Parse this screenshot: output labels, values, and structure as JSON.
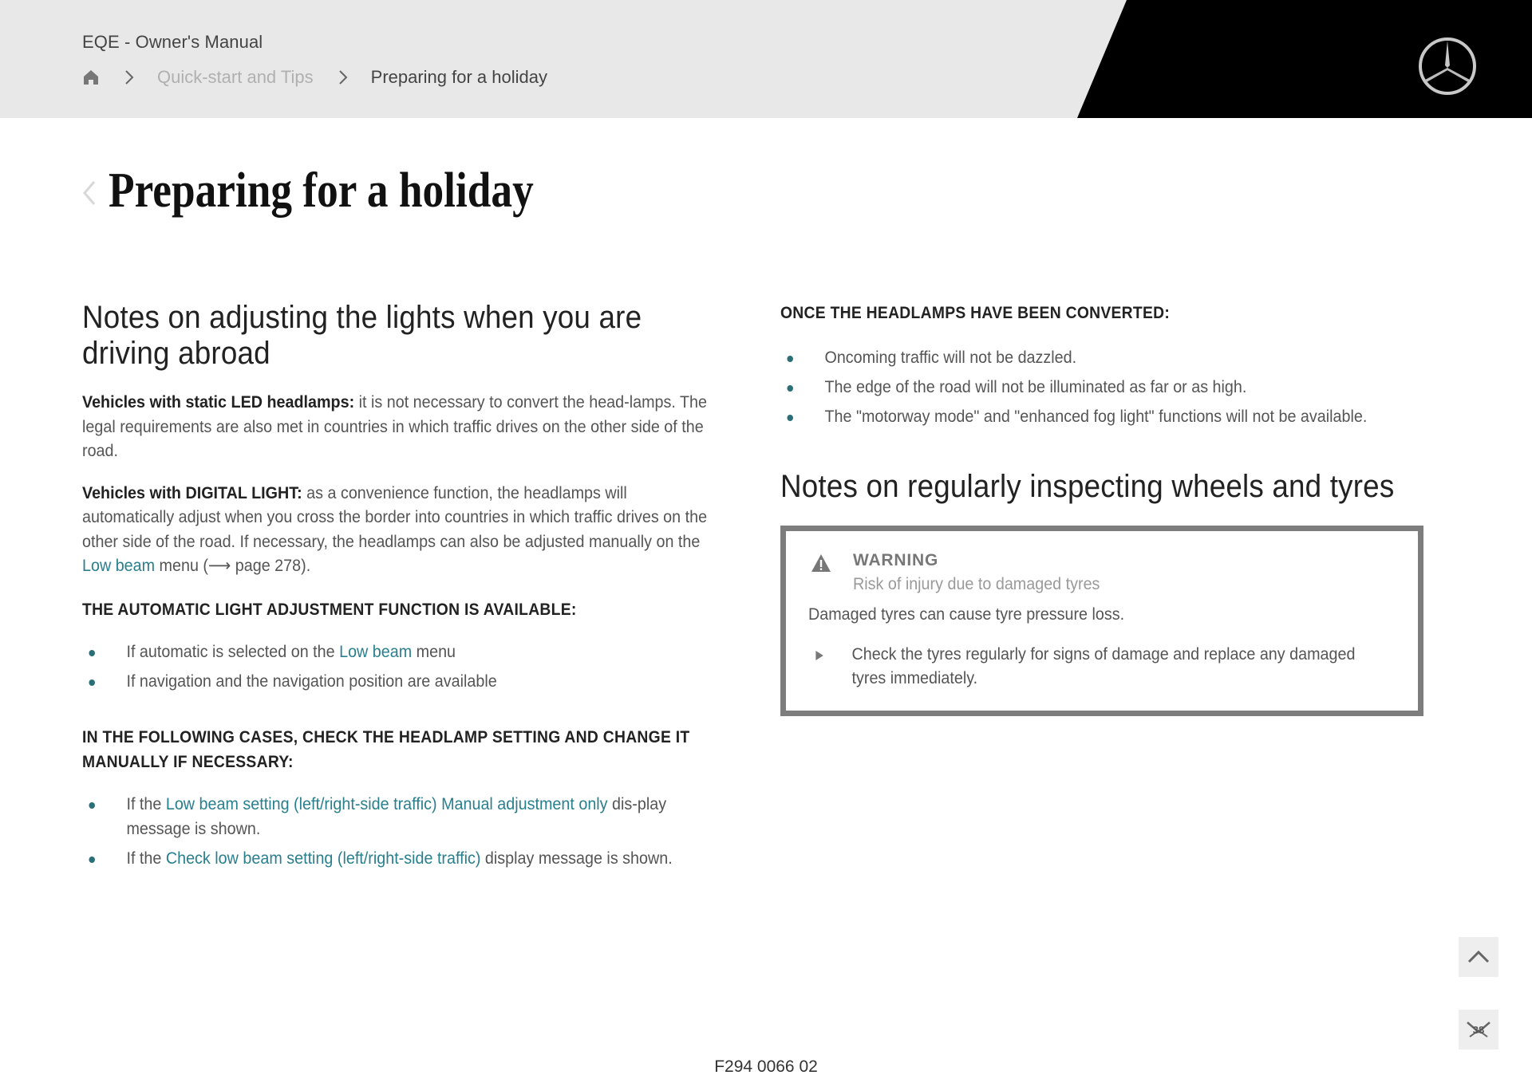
{
  "header": {
    "app_title": "EQE - Owner's Manual",
    "breadcrumb": {
      "home_icon": "home-icon",
      "separator_icon": "chevron-right-icon",
      "items": [
        {
          "label": "Quick-start and Tips"
        },
        {
          "label": "Preparing for a holiday"
        }
      ]
    },
    "logo": "mercedes-star-logo",
    "colors": {
      "bar": "#e8e8e8",
      "brand_block": "#000000"
    }
  },
  "page": {
    "back_icon": "chevron-left-icon",
    "title": "Preparing for a holiday"
  },
  "left_column": {
    "section_title": "Notes on adjusting the lights when you are driving abroad",
    "para1": {
      "bold": "Vehicles with static LED headlamps:",
      "text": " it is not necessary to convert the head-lamps. The legal requirements are also met in countries in which traffic drives on the other side of the road."
    },
    "para2": {
      "bold": "Vehicles with DIGITAL LIGHT:",
      "text_before": " as a convenience function, the headlamps will automatically adjust when you cross the border into countries in which traffic drives on the other side of the road. If necessary, the headlamps can also be adjusted manually on the ",
      "link": "Low beam",
      "text_after": " menu (⟶ page 278)."
    },
    "sub1": {
      "heading": "THE AUTOMATIC LIGHT ADJUSTMENT FUNCTION IS AVAILABLE:",
      "items": [
        {
          "before": "If automatic is selected on the ",
          "link": "Low beam",
          "after": " menu"
        },
        {
          "before": "If navigation and the navigation position are available",
          "link": "",
          "after": ""
        }
      ]
    },
    "sub2": {
      "heading": "IN THE FOLLOWING CASES, CHECK THE HEADLAMP SETTING AND CHANGE IT MANUALLY IF NECESSARY:",
      "items": [
        {
          "before": "If the ",
          "link": "Low beam setting (left/right-side traffic) Manual adjustment only",
          "after": " dis-play message is shown."
        },
        {
          "before": "If the ",
          "link": "Check low beam setting (left/right-side traffic)",
          "after": " display message is shown."
        }
      ]
    }
  },
  "right_column": {
    "sub_heading": "ONCE THE HEADLAMPS HAVE BEEN CONVERTED:",
    "items": [
      "Oncoming traffic will not be dazzled.",
      "The edge of the road will not be illuminated as far or as high.",
      "The \"motorway mode\" and \"enhanced fog light\" functions will not be available."
    ],
    "section_title": "Notes on regularly inspecting wheels and tyres",
    "warning": {
      "icon": "warning-triangle-icon",
      "title": "WARNING",
      "subtitle": "Risk of injury due to damaged tyres",
      "text": "Damaged tyres can cause tyre pressure loss.",
      "step_icon": "play-triangle-icon",
      "step": "Check the tyres regularly for signs of damage and replace any damaged tyres immediately."
    }
  },
  "floating": {
    "scroll_top_icon": "chevron-up-icon",
    "page_badge_icon": "page-badge-icon",
    "page_badge_text": "38"
  },
  "footer": {
    "code": "F294 0066 02"
  },
  "colors": {
    "link": "#2a7f8e",
    "bullet": "#2a6f78",
    "warning_border": "#7d7d7d"
  }
}
